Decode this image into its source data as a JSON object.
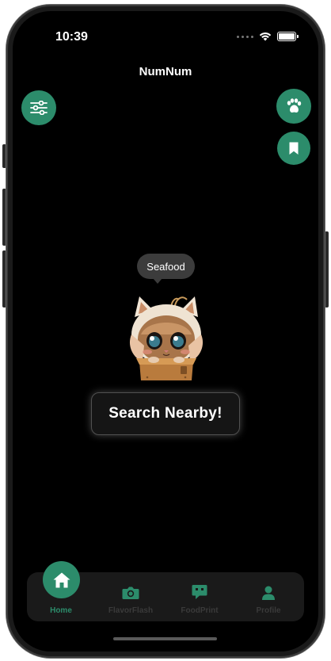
{
  "status_bar": {
    "time": "10:39"
  },
  "header": {
    "title": "NumNum"
  },
  "actions": {
    "filter_icon": "sliders-icon",
    "paw_icon": "paw-icon",
    "bookmark_icon": "bookmark-icon"
  },
  "main": {
    "category_bubble": "Seafood",
    "search_button": "Search Nearby!"
  },
  "tabbar": {
    "items": [
      {
        "label": "Home",
        "icon": "home-icon",
        "active": true
      },
      {
        "label": "FlavorFlash",
        "icon": "camera-icon",
        "active": false
      },
      {
        "label": "FoodPrint",
        "icon": "chat-icon",
        "active": false
      },
      {
        "label": "Profile",
        "icon": "person-icon",
        "active": false
      }
    ]
  },
  "colors": {
    "accent": "#2c8c6b",
    "background": "#000000",
    "tabbar_bg": "#1a1a1a",
    "inactive": "#3a3a3a"
  }
}
